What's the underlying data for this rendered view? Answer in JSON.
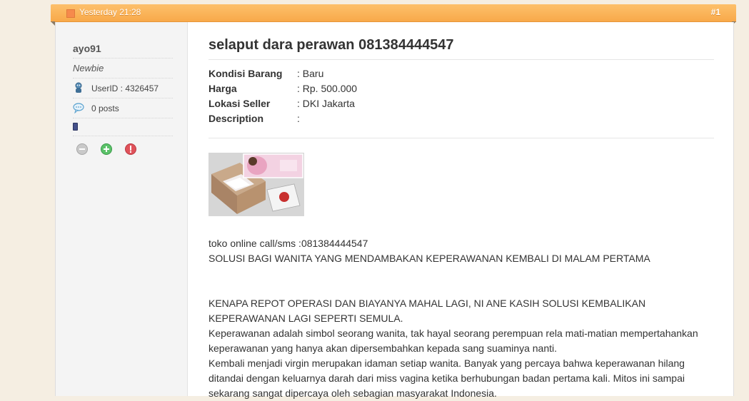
{
  "post": {
    "date": "Yesterday 21:28",
    "number": "#1"
  },
  "user": {
    "name": "ayo91",
    "title": "Newbie",
    "userid": "UserID : 4326457",
    "posts": "0 posts"
  },
  "listing": {
    "title": "selaput dara perawan 081384444547",
    "details": [
      {
        "label": "Kondisi Barang",
        "value": ": Baru"
      },
      {
        "label": "Harga",
        "value": ": Rp. 500.000"
      },
      {
        "label": "Lokasi Seller",
        "value": ": DKI Jakarta"
      },
      {
        "label": "Description",
        "value": ":"
      }
    ]
  },
  "body_text": {
    "line1": "toko online call/sms :081384444547",
    "line2": "SOLUSI BAGI WANITA YANG MENDAMBAKAN KEPERAWANAN KEMBALI DI MALAM PERTAMA",
    "para1": "KENAPA REPOT OPERASI DAN BIAYANYA MAHAL LAGI, NI ANE KASIH SOLUSI KEMBALIKAN KEPERAWANAN LAGI SEPERTI SEMULA.",
    "para2": "Keperawanan adalah simbol seorang wanita, tak hayal seorang perempuan rela mati-matian mempertahankan keperawanan yang hanya akan dipersembahkan kepada sang suaminya nanti.",
    "para3": "Kembali menjadi virgin merupakan idaman setiap wanita. Banyak yang percaya bahwa keperawanan hilang ditandai dengan keluarnya darah dari miss vagina ketika berhubungan badan pertama kali. Mitos ini sampai sekarang sangat dipercaya oleh sebagian masyarakat Indonesia."
  },
  "colors": {
    "header_orange": "#f8a94a",
    "sidebar_bg": "#f4f4f4",
    "page_bg": "#f5eee2"
  },
  "icons": [
    "post-status-icon",
    "userid-icon",
    "posts-icon",
    "reputation-icon",
    "neutral-rep-icon",
    "add-rep-icon",
    "report-icon"
  ]
}
